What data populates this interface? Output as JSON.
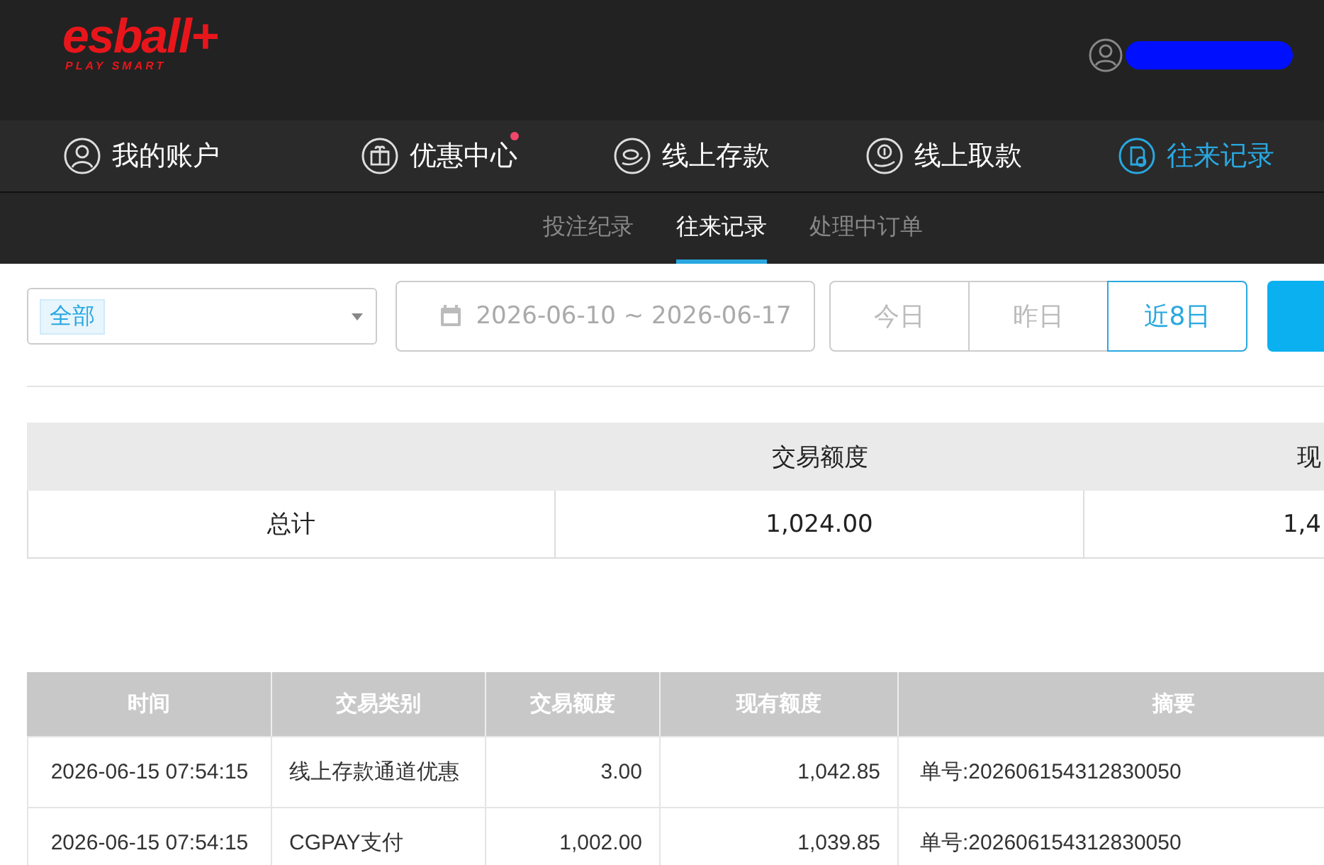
{
  "header": {
    "logo": "esball+",
    "tagline": "PLAY SMART"
  },
  "nav": [
    {
      "label": "我的账户",
      "kind": "user",
      "selected": false,
      "badge": false
    },
    {
      "label": "优惠中心",
      "kind": "gift",
      "selected": false,
      "badge": true
    },
    {
      "label": "线上存款",
      "kind": "deposit",
      "selected": false,
      "badge": false
    },
    {
      "label": "线上取款",
      "kind": "withdraw",
      "selected": false,
      "badge": false
    },
    {
      "label": "往来记录",
      "kind": "records",
      "selected": true,
      "badge": false
    }
  ],
  "subtabs": [
    {
      "label": "投注纪录",
      "selected": false
    },
    {
      "label": "往来记录",
      "selected": true
    },
    {
      "label": "处理中订单",
      "selected": false
    }
  ],
  "filter": {
    "type_tags": [
      "全部"
    ],
    "date_range": "2026-06-10 ~ 2026-06-17",
    "quick_ranges": [
      {
        "label": "今日",
        "selected": false
      },
      {
        "label": "昨日",
        "selected": false
      },
      {
        "label": "近8日",
        "selected": true
      }
    ]
  },
  "summary": {
    "row_label": "总计",
    "columns": [
      {
        "heading": "交易额度",
        "value": "1,024.00"
      },
      {
        "heading": "现",
        "value": "1,4"
      }
    ]
  },
  "records": {
    "columns": [
      "时间",
      "交易类别",
      "交易额度",
      "现有额度",
      "摘要"
    ],
    "rows": [
      [
        "2026-06-15 07:54:15",
        "线上存款通道优惠",
        "3.00",
        "1,042.85",
        "单号:202606154312830050"
      ],
      [
        "2026-06-15 07:54:15",
        "CGPAY支付",
        "1,002.00",
        "1,039.85",
        "单号:202606154312830050"
      ]
    ]
  }
}
